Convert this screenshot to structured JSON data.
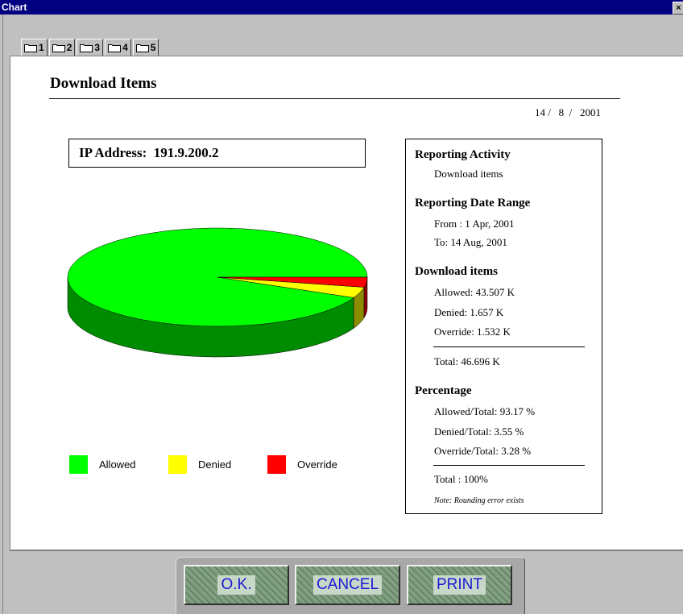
{
  "window": {
    "title": "Chart",
    "close_glyph": "×"
  },
  "tabs": [
    "1",
    "2",
    "3",
    "4",
    "5"
  ],
  "report": {
    "heading": "Download Items",
    "date": "14 /   8  /   2001",
    "ip_address": "IP Address:  191.9.200.2"
  },
  "legend": [
    {
      "label": "Allowed",
      "color": "#00ff00"
    },
    {
      "label": "Denied",
      "color": "#ffff00"
    },
    {
      "label": "Override",
      "color": "#ff0000"
    }
  ],
  "chart_data": {
    "type": "pie",
    "categories": [
      "Allowed",
      "Denied",
      "Override"
    ],
    "values": [
      43.507,
      1.657,
      1.532
    ],
    "colors": [
      "#00ff00",
      "#ffff00",
      "#ff0000"
    ]
  },
  "info": {
    "activity_heading": "Reporting Activity",
    "activity_value": "Download items",
    "date_range_heading": "Reporting Date Range",
    "from": "From : 1 Apr, 2001",
    "to": "To:  14 Aug, 2001",
    "download_heading": "Download items",
    "allowed": "Allowed: 43.507 K",
    "denied": "Denied: 1.657 K",
    "override": "Override: 1.532 K",
    "total": "Total: 46.696 K",
    "percentage_heading": "Percentage",
    "allowed_pct": "Allowed/Total: 93.17 %",
    "denied_pct": "Denied/Total:  3.55 %",
    "override_pct": "Override/Total:   3.28 %",
    "total_pct": "Total :        100%",
    "note": "Note: Rounding error exists"
  },
  "buttons": {
    "ok": "O.K.",
    "cancel": "CANCEL",
    "print": "PRINT"
  }
}
